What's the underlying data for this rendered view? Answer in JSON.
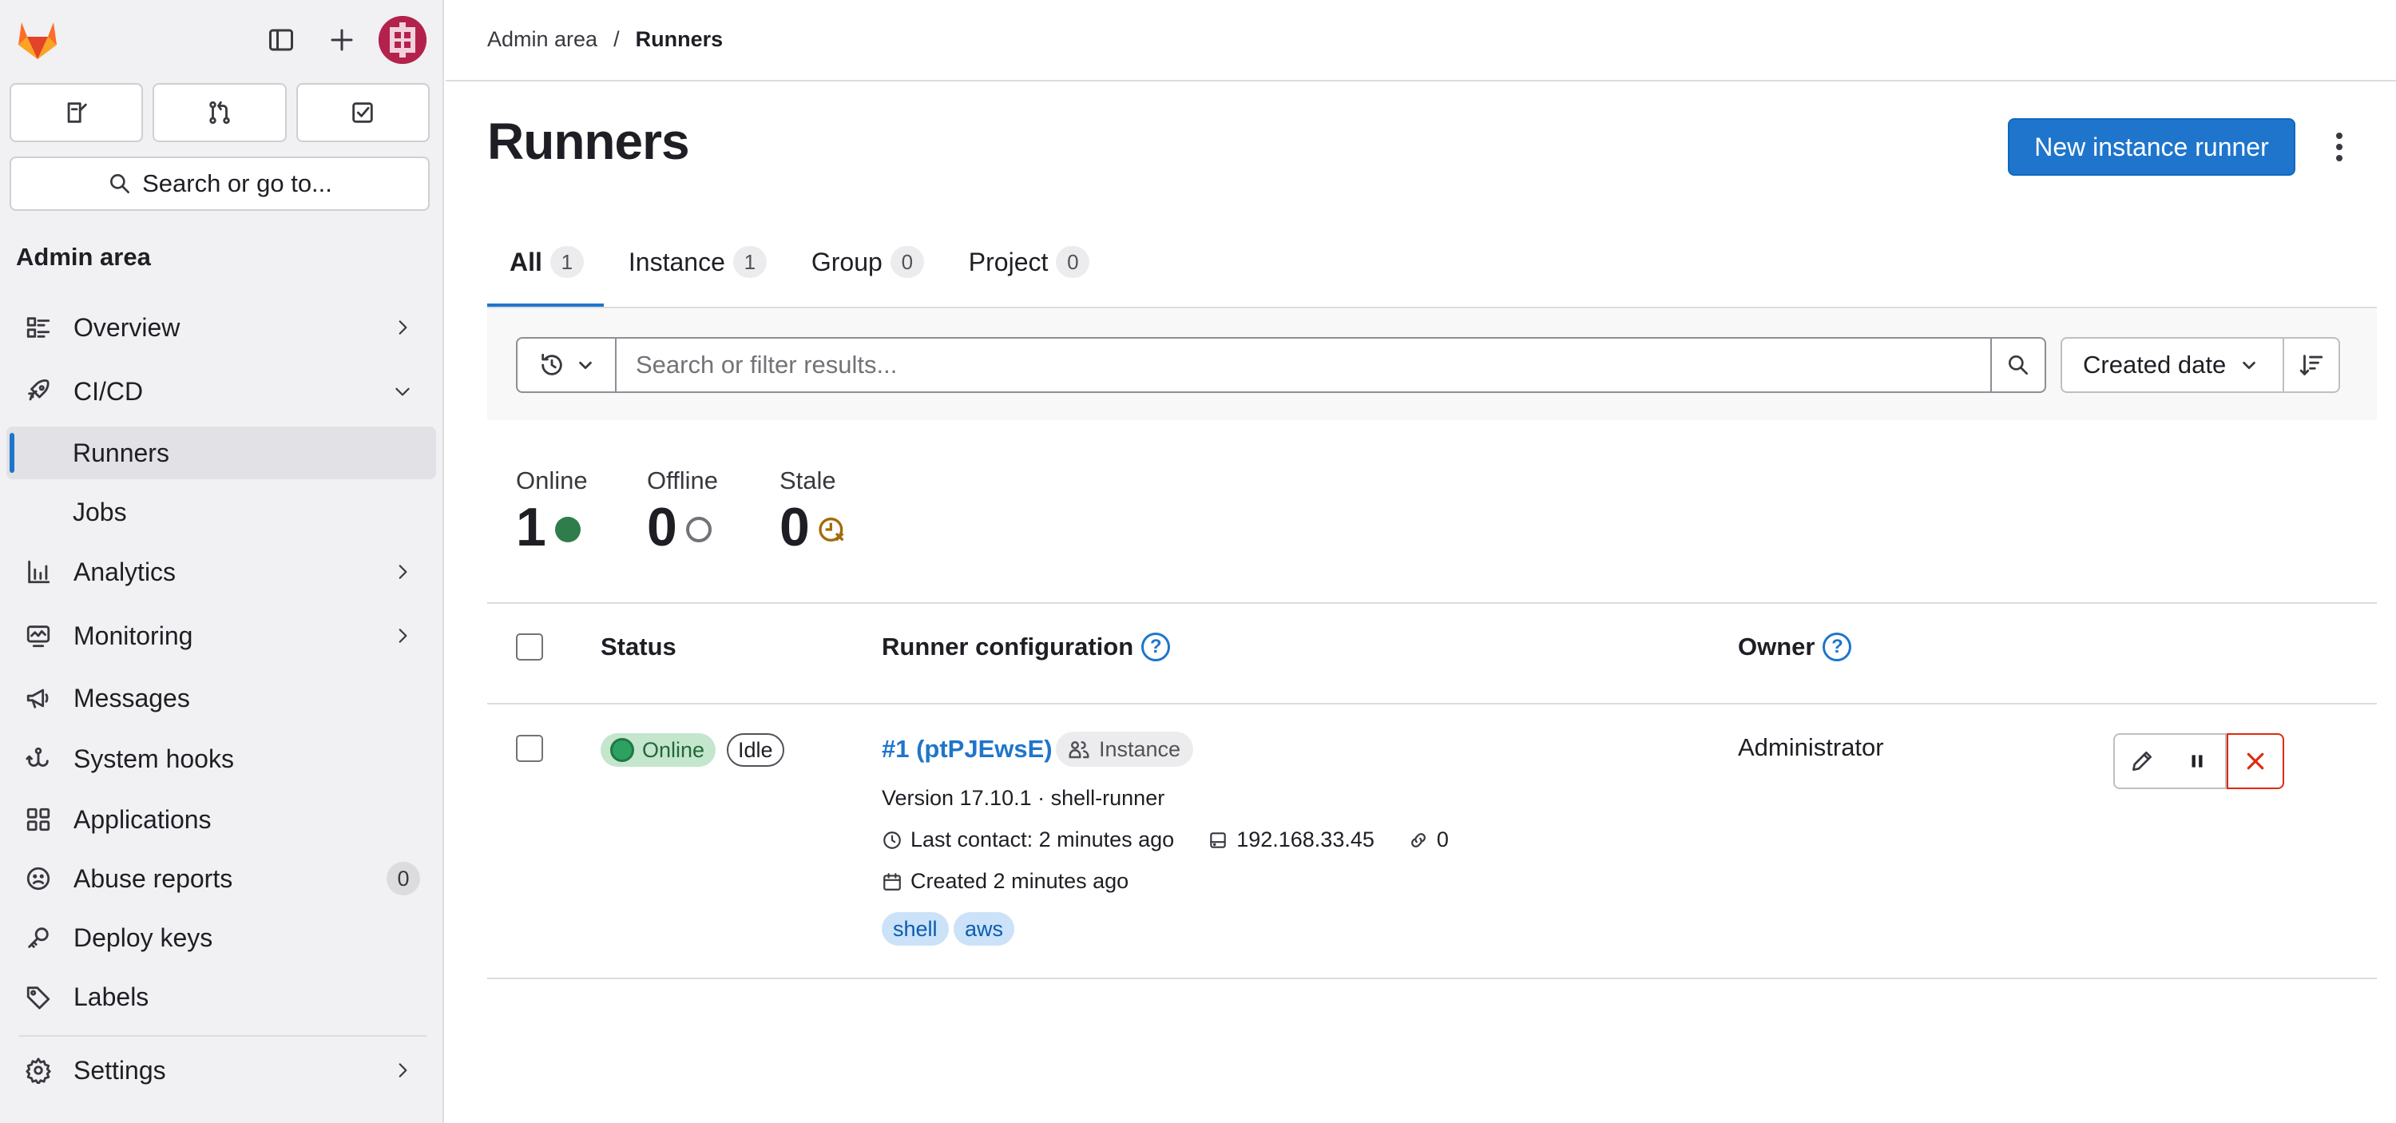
{
  "sidebar": {
    "search_label": "Search or go to...",
    "section_title": "Admin area",
    "items": [
      {
        "label": "Overview"
      },
      {
        "label": "CI/CD"
      },
      {
        "label": "Runners"
      },
      {
        "label": "Jobs"
      },
      {
        "label": "Analytics"
      },
      {
        "label": "Monitoring"
      },
      {
        "label": "Messages"
      },
      {
        "label": "System hooks"
      },
      {
        "label": "Applications"
      },
      {
        "label": "Abuse reports",
        "count": "0"
      },
      {
        "label": "Deploy keys"
      },
      {
        "label": "Labels"
      },
      {
        "label": "Settings"
      }
    ]
  },
  "breadcrumb": {
    "parent": "Admin area",
    "separator": "/",
    "current": "Runners"
  },
  "page": {
    "title": "Runners",
    "primary_button": "New instance runner"
  },
  "tabs": [
    {
      "label": "All",
      "count": "1"
    },
    {
      "label": "Instance",
      "count": "1"
    },
    {
      "label": "Group",
      "count": "0"
    },
    {
      "label": "Project",
      "count": "0"
    }
  ],
  "filter": {
    "placeholder": "Search or filter results...",
    "sort_label": "Created date"
  },
  "stats": [
    {
      "label": "Online",
      "value": "1"
    },
    {
      "label": "Offline",
      "value": "0"
    },
    {
      "label": "Stale",
      "value": "0"
    }
  ],
  "table": {
    "headers": {
      "status": "Status",
      "config": "Runner configuration",
      "owner": "Owner"
    },
    "rows": [
      {
        "status": "Online",
        "state": "Idle",
        "name": "#1 (ptPJEwsE)",
        "type": "Instance",
        "version": "Version 17.10.1 · shell-runner",
        "last_contact": "Last contact: 2 minutes ago",
        "ip": "192.168.33.45",
        "jobs": "0",
        "created": "Created 2 minutes ago",
        "tags": [
          "shell",
          "aws"
        ],
        "owner": "Administrator"
      }
    ]
  },
  "colors": {
    "accent": "#1f75cb",
    "online": "#2da160",
    "offline": "#737278",
    "stale": "#c17d10",
    "danger": "#dd2b0e"
  }
}
